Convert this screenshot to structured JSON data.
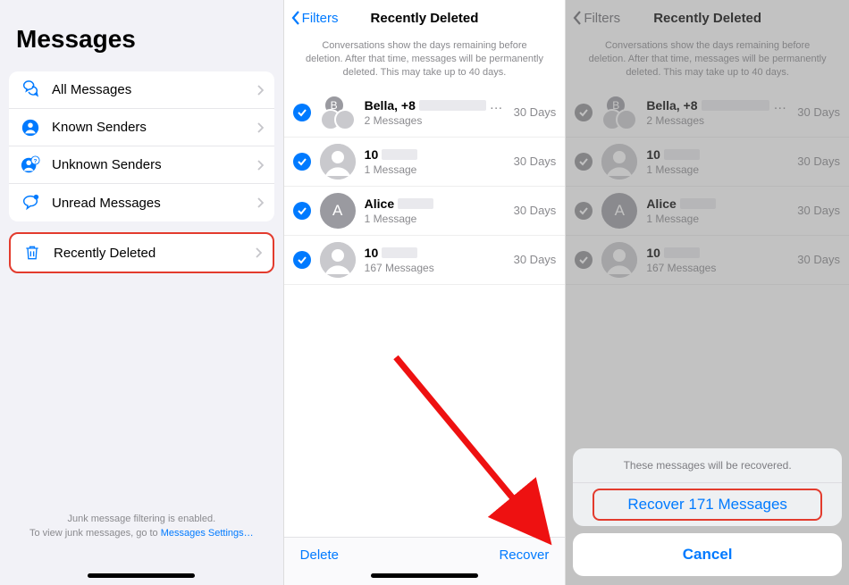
{
  "panel1": {
    "title": "Messages",
    "items": [
      {
        "label": "All Messages"
      },
      {
        "label": "Known Senders"
      },
      {
        "label": "Unknown Senders"
      },
      {
        "label": "Unread Messages"
      }
    ],
    "special": {
      "label": "Recently Deleted"
    },
    "footer1": "Junk message filtering is enabled.",
    "footer2a": "To view junk messages, go to ",
    "footer2b": "Messages Settings…"
  },
  "panel2": {
    "back": "Filters",
    "title": "Recently Deleted",
    "subhead": "Conversations show the days remaining before deletion. After that time, messages will be permanently deleted. This may take up to 40 days.",
    "chats": [
      {
        "name": "Bella, +8",
        "sub": "2 Messages",
        "days": "30 Days",
        "avatar": "group",
        "more": true
      },
      {
        "name": "10",
        "sub": "1 Message",
        "days": "30 Days",
        "avatar": "person"
      },
      {
        "name": "Alice",
        "sub": "1 Message",
        "days": "30 Days",
        "avatar": "letter",
        "letter": "A"
      },
      {
        "name": "10",
        "sub": "167 Messages",
        "days": "30 Days",
        "avatar": "person"
      }
    ],
    "delete": "Delete",
    "recover": "Recover"
  },
  "panel3": {
    "back": "Filters",
    "title": "Recently Deleted",
    "sheet_header": "These messages will be recovered.",
    "sheet_action": "Recover 171 Messages",
    "sheet_cancel": "Cancel"
  }
}
